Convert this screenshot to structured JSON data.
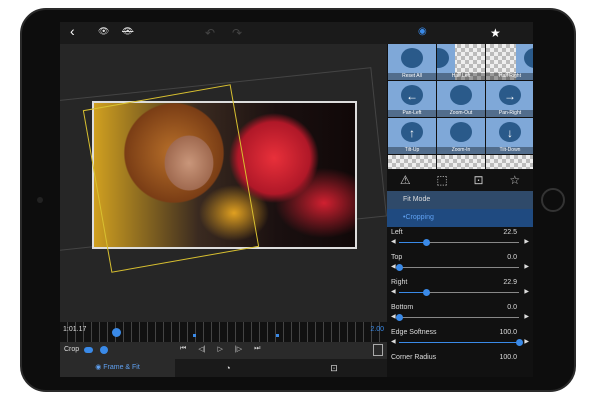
{
  "topbar": {
    "back": "‹",
    "preview1": "👁",
    "preview2": "👁",
    "undo": "↶",
    "redo": "↷",
    "frame_icon": "◉",
    "star": "★"
  },
  "presets": [
    {
      "label": "Reset All",
      "type": "full"
    },
    {
      "label": "Half Left",
      "type": "half-left"
    },
    {
      "label": "Half Right",
      "type": "half-right"
    },
    {
      "label": "Pan-Left",
      "type": "full",
      "arrow": "←"
    },
    {
      "label": "Zoom-Out",
      "type": "full"
    },
    {
      "label": "Pan-Right",
      "type": "full",
      "arrow": "→"
    },
    {
      "label": "Tilt-Up",
      "type": "full",
      "arrow": "↑"
    },
    {
      "label": "Zoom-In",
      "type": "full"
    },
    {
      "label": "Tilt-Down",
      "type": "full",
      "arrow": "↓"
    }
  ],
  "tools": {
    "t1": "⚠",
    "t2": "⬚",
    "t3": "⊡",
    "t4": "☆"
  },
  "sections": {
    "fit_mode": "Fit Mode",
    "cropping": "•Cropping"
  },
  "params": [
    {
      "label": "Left",
      "value": "22.5",
      "fraction": 0.225
    },
    {
      "label": "Top",
      "value": "0.0",
      "fraction": 0
    },
    {
      "label": "Right",
      "value": "22.9",
      "fraction": 0.229
    },
    {
      "label": "Bottom",
      "value": "0.0",
      "fraction": 0
    },
    {
      "label": "Edge Softness",
      "value": "100.0",
      "fraction": 1
    }
  ],
  "corner_radius": {
    "label": "Corner Radius",
    "value": "100.0"
  },
  "timeline": {
    "current": "1:01.17",
    "end": "2.00"
  },
  "controls": {
    "crop_label": "Crop",
    "buttons": [
      "⏮",
      "◁|",
      "▷",
      "|▷",
      "⏭"
    ]
  },
  "tabs": {
    "frame_fit": "Frame & Fit"
  },
  "colors": {
    "accent": "#3a8ae8",
    "selection": "#d8c030"
  }
}
